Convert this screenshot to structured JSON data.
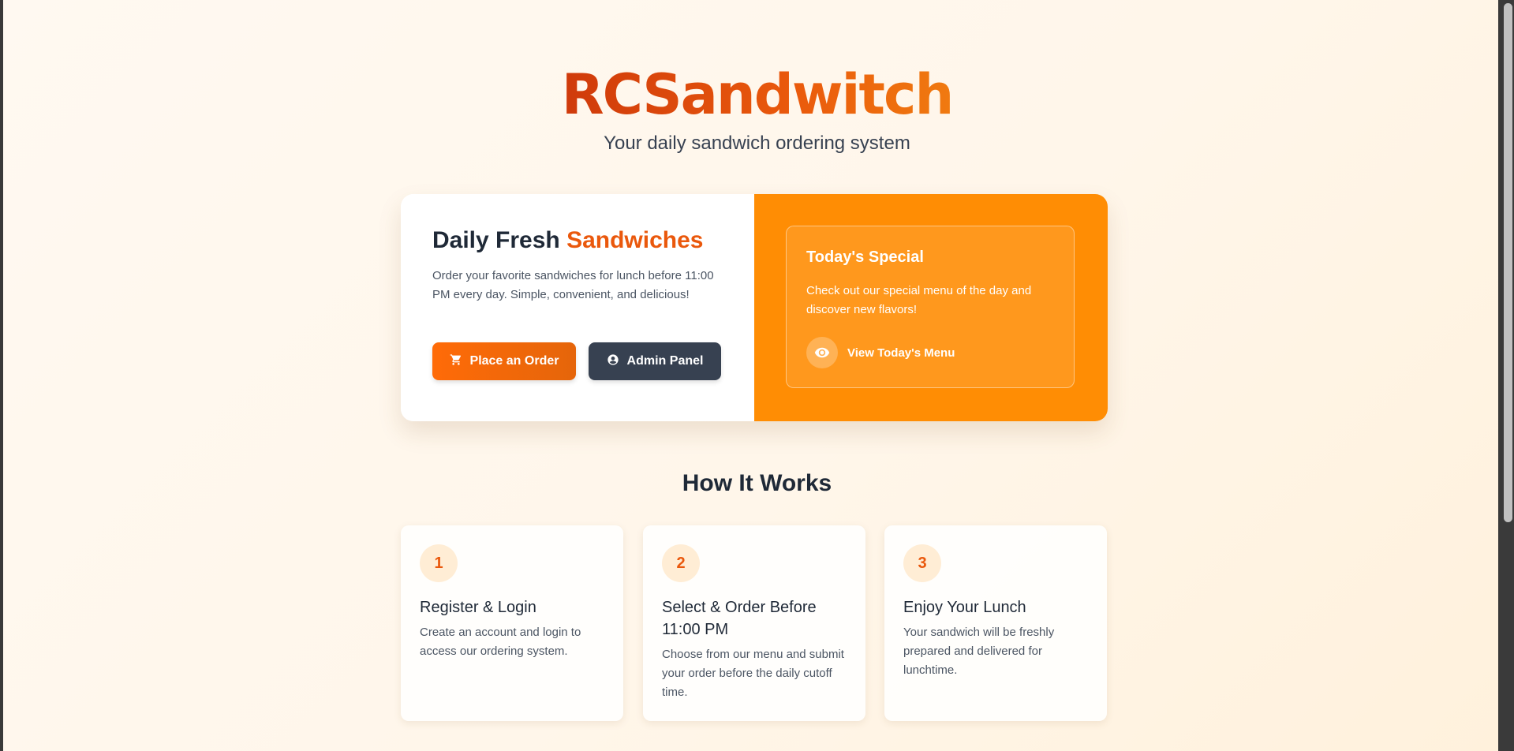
{
  "header": {
    "title": "RCSandwitch",
    "subtitle": "Your daily sandwich ordering system"
  },
  "hero": {
    "heading_plain": "Daily Fresh",
    "heading_accent": "Sandwiches",
    "description": "Order your favorite sandwiches for lunch before 11:00 PM every day. Simple, convenient, and delicious!",
    "order_button": {
      "label": "Place an Order",
      "icon": "cart-icon"
    },
    "admin_button": {
      "label": "Admin Panel",
      "icon": "user-circle-icon"
    }
  },
  "special": {
    "title": "Today's Special",
    "text": "Check out our special menu of the day and discover new flavors!",
    "link_label": "View Today's Menu",
    "link_icon": "eye-icon"
  },
  "how_it_works": {
    "title": "How It Works",
    "steps": [
      {
        "number": "1",
        "title": "Register & Login",
        "text": "Create an account and login to access our ordering system."
      },
      {
        "number": "2",
        "title": "Select & Order Before 11:00 PM",
        "text": "Choose from our menu and submit your order before the daily cutoff time."
      },
      {
        "number": "3",
        "title": "Enjoy Your Lunch",
        "text": "Your sandwich will be freshly prepared and delivered for lunchtime."
      }
    ]
  },
  "colors": {
    "brand": "#ea580c",
    "hero_panel": "#ff8d04",
    "admin_button": "#374151",
    "step_badge_bg": "#ffedd5"
  }
}
